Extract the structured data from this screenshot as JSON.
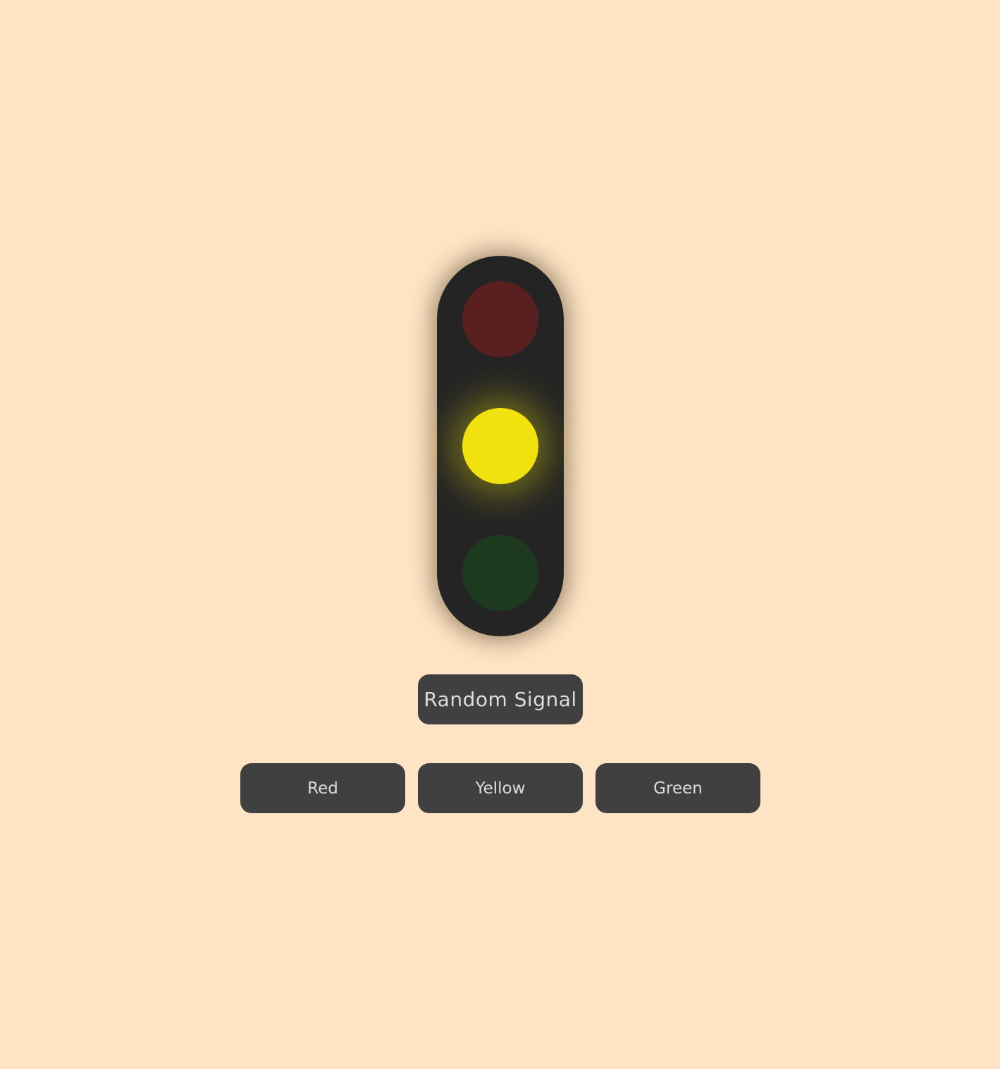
{
  "traffic_light": {
    "active": "yellow",
    "lamps": [
      {
        "id": "red",
        "on_color": "#e2231a",
        "off_color": "#5a2020"
      },
      {
        "id": "yellow",
        "on_color": "#f0e20e",
        "off_color": "#4a4410"
      },
      {
        "id": "green",
        "on_color": "#22c322",
        "off_color": "#1e3a1e"
      }
    ]
  },
  "controls": {
    "random_label": "Random Signal",
    "red_label": "Red",
    "yellow_label": "Yellow",
    "green_label": "Green"
  },
  "colors": {
    "background": "#fee4c4",
    "housing": "#242424",
    "button_bg": "#404040",
    "button_text": "#dcdcdc"
  }
}
